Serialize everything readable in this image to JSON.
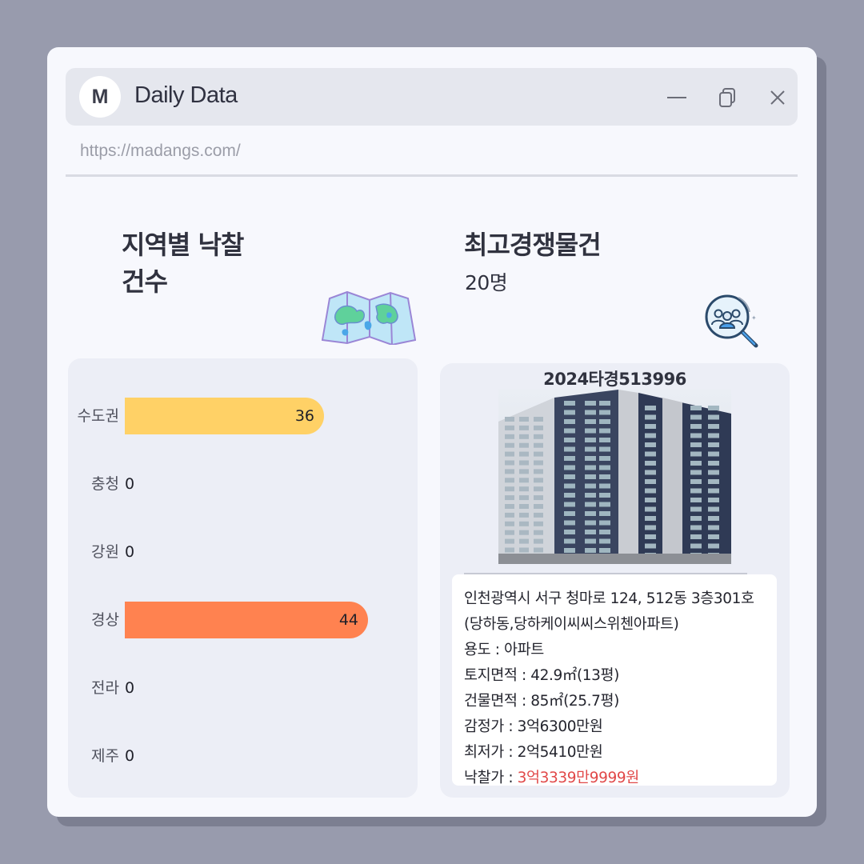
{
  "window": {
    "logo_letter": "M",
    "title": "Daily Data",
    "url": "https://madangs.com/"
  },
  "left": {
    "title_line1": "지역별 낙찰",
    "title_line2": "건수",
    "illustration": "folded-map-icon",
    "bars": [
      {
        "label": "수도권",
        "value": 36,
        "color": "#ffd166"
      },
      {
        "label": "충청",
        "value": 0,
        "color": "#ffd166"
      },
      {
        "label": "강원",
        "value": 0,
        "color": "#ffd166"
      },
      {
        "label": "경상",
        "value": 44,
        "color": "#ff8250"
      },
      {
        "label": "전라",
        "value": 0,
        "color": "#ffd166"
      },
      {
        "label": "제주",
        "value": 0,
        "color": "#ffd166"
      }
    ]
  },
  "right": {
    "title": "최고경쟁물건",
    "subtitle": "20명",
    "illustration": "people-search-icon",
    "case_number": "2024타경513996",
    "info": {
      "address1": "인천광역시 서구 청마로 124, 512동 3층301호",
      "address2": "(당하동,당하케이씨씨스위첸아파트)",
      "usage": "용도 : 아파트",
      "land_area": "토지면적 : 42.9㎡(13평)",
      "building_area": "건물면적 : 85㎡(25.7평)",
      "appraisal": "감정가 : 3억6300만원",
      "minimum": "최저가 : 2억5410만원",
      "winning_label": "낙찰가 : ",
      "winning_price": "3억3339만9999원"
    }
  },
  "colors": {
    "accent_red": "#e14949",
    "bar_yellow": "#ffd166",
    "bar_orange": "#ff8250"
  }
}
